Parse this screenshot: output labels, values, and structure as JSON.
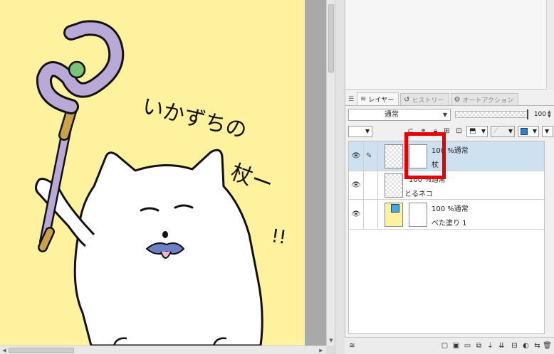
{
  "canvas": {
    "drawing_texts": {
      "line1": "いかずちの",
      "line2": "杖ー",
      "exclaim": "!!"
    }
  },
  "layer_panel": {
    "tabs": [
      {
        "label": "レイヤー",
        "icon": "layer-stack-icon",
        "active": true
      },
      {
        "label": "ヒストリー",
        "icon": "history-icon",
        "active": false
      },
      {
        "label": "オートアクション",
        "icon": "auto-action-icon",
        "active": false
      }
    ],
    "blend_mode": "通常",
    "opacity_value": "100",
    "opacity_fraction": 1.0,
    "layers": [
      {
        "label_top": "100 %通常",
        "label_bottom": "杖",
        "selected": true,
        "thumb": "checker",
        "has_mask": true
      },
      {
        "label_top": "100 %通常",
        "label_bottom": "とるネコ",
        "selected": false,
        "thumb": "checker",
        "has_mask": false
      },
      {
        "label_top": "100 %通常",
        "label_bottom": "べた塗り 1",
        "selected": false,
        "thumb": "yellow",
        "has_mask": true
      }
    ]
  },
  "colors": {
    "paper": "#fff29e",
    "selected_row": "#cde1f0",
    "highlight": "#e60000",
    "staff": "#b9a9d6"
  }
}
